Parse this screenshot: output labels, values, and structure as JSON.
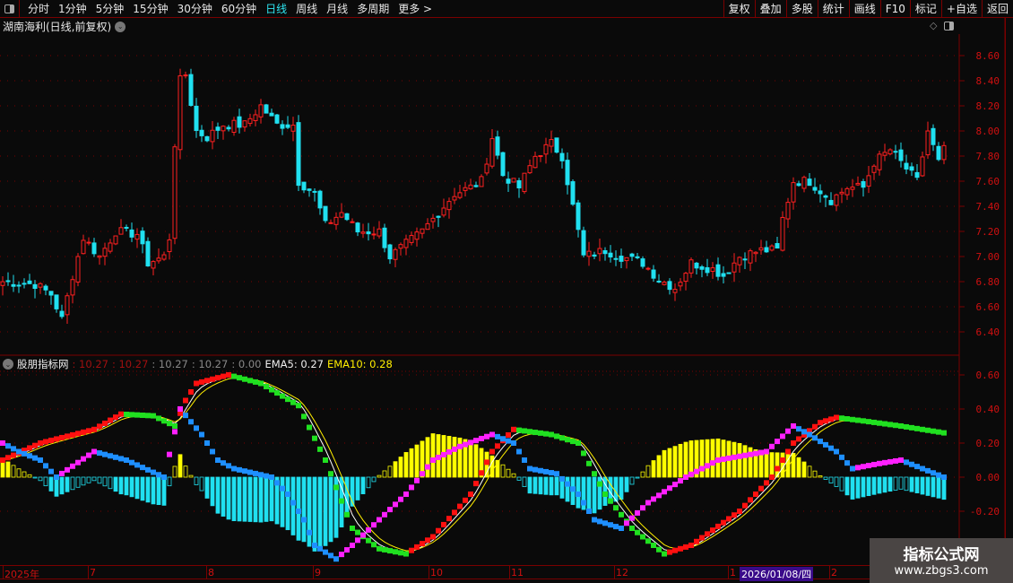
{
  "toolbar": {
    "periods": [
      "分时",
      "1分钟",
      "5分钟",
      "15分钟",
      "30分钟",
      "60分钟",
      "日线",
      "周线",
      "月线",
      "多周期",
      "更多 >"
    ],
    "active": "日线",
    "buttons": [
      "复权",
      "叠加",
      "多股",
      "统计",
      "画线",
      "F10",
      "标记",
      "+自选",
      "返回"
    ]
  },
  "chart": {
    "title": "湖南海利(日线,前复权)",
    "price_ticks": [
      "8.60",
      "8.40",
      "8.20",
      "8.00",
      "7.80",
      "7.60",
      "7.40",
      "7.20",
      "7.00",
      "6.80",
      "6.60",
      "6.40"
    ],
    "price_keypoints": [
      [
        0,
        6.8
      ],
      [
        6,
        6.78
      ],
      [
        9,
        6.7
      ],
      [
        11,
        6.5
      ],
      [
        13,
        6.85
      ],
      [
        15,
        7.15
      ],
      [
        18,
        7.0
      ],
      [
        21,
        7.2
      ],
      [
        25,
        7.18
      ],
      [
        27,
        6.95
      ],
      [
        30,
        7.0
      ],
      [
        31,
        7.15
      ],
      [
        32,
        7.9
      ],
      [
        33,
        8.4
      ],
      [
        34,
        8.45
      ],
      [
        36,
        8.0
      ],
      [
        38,
        7.95
      ],
      [
        41,
        8.05
      ],
      [
        45,
        8.05
      ],
      [
        48,
        8.2
      ],
      [
        51,
        8.05
      ],
      [
        54,
        8.05
      ],
      [
        55,
        7.6
      ],
      [
        58,
        7.5
      ],
      [
        60,
        7.25
      ],
      [
        63,
        7.35
      ],
      [
        66,
        7.2
      ],
      [
        70,
        7.2
      ],
      [
        72,
        7.0
      ],
      [
        75,
        7.1
      ],
      [
        78,
        7.2
      ],
      [
        81,
        7.35
      ],
      [
        84,
        7.5
      ],
      [
        87,
        7.55
      ],
      [
        89,
        7.6
      ],
      [
        91,
        7.95
      ],
      [
        93,
        7.65
      ],
      [
        96,
        7.55
      ],
      [
        99,
        7.8
      ],
      [
        102,
        7.9
      ],
      [
        104,
        7.8
      ],
      [
        106,
        7.4
      ],
      [
        108,
        7.0
      ],
      [
        112,
        7.05
      ],
      [
        115,
        7.0
      ],
      [
        119,
        6.95
      ],
      [
        122,
        6.82
      ],
      [
        125,
        6.75
      ],
      [
        128,
        6.95
      ],
      [
        132,
        6.9
      ],
      [
        134,
        6.85
      ],
      [
        137,
        7.0
      ],
      [
        141,
        7.05
      ],
      [
        144,
        7.05
      ],
      [
        145,
        7.3
      ],
      [
        147,
        7.6
      ],
      [
        150,
        7.6
      ],
      [
        154,
        7.45
      ],
      [
        157,
        7.55
      ],
      [
        160,
        7.55
      ],
      [
        162,
        7.75
      ],
      [
        165,
        7.85
      ],
      [
        168,
        7.7
      ],
      [
        170,
        7.6
      ],
      [
        172,
        8.0
      ],
      [
        174,
        7.75
      ],
      [
        175,
        7.85
      ]
    ],
    "ind_keypoints_a": [
      [
        0,
        0.1
      ],
      [
        7,
        0.2
      ],
      [
        17,
        0.28
      ],
      [
        22,
        0.37
      ],
      [
        28,
        0.36
      ],
      [
        32,
        0.3
      ],
      [
        34,
        0.45
      ],
      [
        36,
        0.55
      ],
      [
        42,
        0.6
      ],
      [
        48,
        0.55
      ],
      [
        55,
        0.42
      ],
      [
        60,
        0.1
      ],
      [
        65,
        -0.3
      ],
      [
        70,
        -0.42
      ],
      [
        75,
        -0.45
      ],
      [
        80,
        -0.35
      ],
      [
        87,
        -0.1
      ],
      [
        91,
        0.15
      ],
      [
        95,
        0.28
      ],
      [
        102,
        0.25
      ],
      [
        107,
        0.2
      ],
      [
        112,
        -0.1
      ],
      [
        117,
        -0.3
      ],
      [
        123,
        -0.45
      ],
      [
        128,
        -0.4
      ],
      [
        137,
        -0.2
      ],
      [
        143,
        0.0
      ],
      [
        147,
        0.2
      ],
      [
        152,
        0.32
      ],
      [
        155,
        0.35
      ],
      [
        160,
        0.33
      ],
      [
        167,
        0.3
      ],
      [
        175,
        0.26
      ]
    ],
    "ind_keypoints_b": [
      [
        0,
        0.2
      ],
      [
        3,
        0.15
      ],
      [
        7,
        0.1
      ],
      [
        10,
        0.0
      ],
      [
        17,
        0.15
      ],
      [
        23,
        0.1
      ],
      [
        30,
        0.0
      ],
      [
        33,
        0.4
      ],
      [
        37,
        0.25
      ],
      [
        40,
        0.1
      ],
      [
        43,
        0.05
      ],
      [
        50,
        0.0
      ],
      [
        53,
        -0.1
      ],
      [
        56,
        -0.25
      ],
      [
        58,
        -0.4
      ],
      [
        62,
        -0.48
      ],
      [
        65,
        -0.4
      ],
      [
        70,
        -0.25
      ],
      [
        75,
        -0.1
      ],
      [
        80,
        0.1
      ],
      [
        85,
        0.18
      ],
      [
        91,
        0.25
      ],
      [
        95,
        0.2
      ],
      [
        98,
        0.05
      ],
      [
        103,
        0.02
      ],
      [
        107,
        -0.1
      ],
      [
        110,
        -0.25
      ],
      [
        115,
        -0.3
      ],
      [
        120,
        -0.15
      ],
      [
        127,
        0.0
      ],
      [
        133,
        0.1
      ],
      [
        142,
        0.15
      ],
      [
        147,
        0.3
      ],
      [
        150,
        0.25
      ],
      [
        155,
        0.15
      ],
      [
        158,
        0.05
      ],
      [
        163,
        0.08
      ],
      [
        167,
        0.1
      ],
      [
        175,
        0.0
      ]
    ]
  },
  "indicator": {
    "name": "股朋指标网",
    "values": [
      ": 10.27",
      ": 10.27",
      ": 10.27",
      ": 10.27",
      ": 0.00"
    ],
    "ema5": "EMA5: 0.27",
    "ema10": "EMA10: 0.28",
    "ticks": [
      "0.60",
      "0.40",
      "0.20",
      "0.00",
      "-0.20"
    ]
  },
  "dates": {
    "labels": [
      "2025年",
      "7",
      "8",
      "9",
      "10",
      "11",
      "12",
      "1",
      "2"
    ],
    "cursor": "2026/01/08/四"
  },
  "watermark": {
    "line1": "指标公式网",
    "line2": "www.zbgs3.com"
  },
  "colors": {
    "up": "#ff2020",
    "down": "#20e0f0",
    "grid": "#7a0000",
    "axis": "#d01010"
  }
}
